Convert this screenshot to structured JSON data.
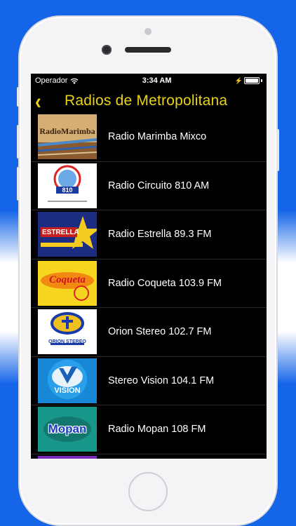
{
  "status_bar": {
    "carrier": "Operador",
    "time": "3:34 AM",
    "battery_level": 1.0
  },
  "nav": {
    "back_icon": "chevron-left-icon",
    "title": "Radios de Metropolitana"
  },
  "colors": {
    "accent": "#E8D21A",
    "background": "#000000",
    "text": "#FFFFFF",
    "frame_bg": "#1565E8"
  },
  "stations": [
    {
      "name": "Radio Marimba Mixco",
      "logo_text": "RadioMarimba"
    },
    {
      "name": "Radio Circuito 810 AM",
      "logo_text": "810"
    },
    {
      "name": "Radio Estrella 89.3 FM",
      "logo_text": "ESTRELLA"
    },
    {
      "name": "Radio Coqueta 103.9 FM",
      "logo_text": "Coqueta"
    },
    {
      "name": "Orion Stereo 102.7 FM",
      "logo_text": "ORION STEREO"
    },
    {
      "name": "Stereo Vision 104.1 FM",
      "logo_text": "VISION"
    },
    {
      "name": "Radio Mopan 108 FM",
      "logo_text": "Mopan"
    }
  ]
}
